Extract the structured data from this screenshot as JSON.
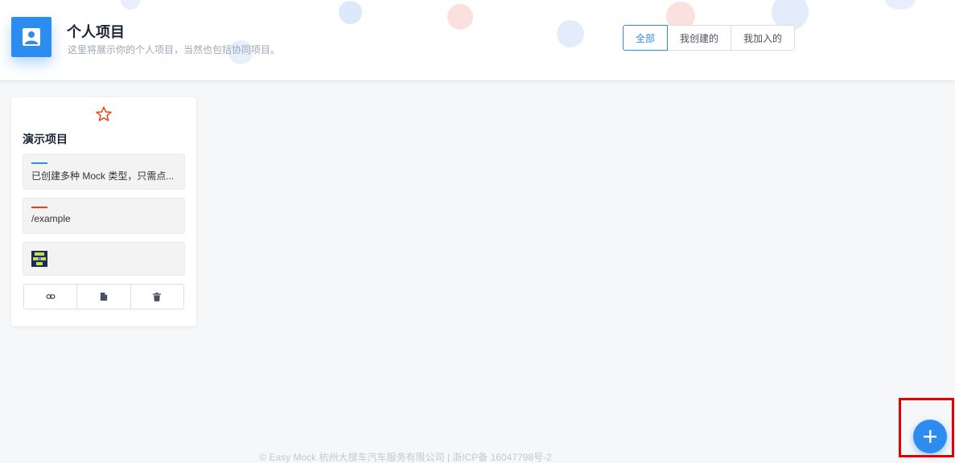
{
  "header": {
    "title": "个人项目",
    "subtitle": "这里将展示你的个人项目，当然也包括协同项目。",
    "avatar_icon": "user-icon",
    "accent_color": "#2d8cf0"
  },
  "filters": {
    "items": [
      "全部",
      "我创建的",
      "我加入的"
    ],
    "selected": "全部"
  },
  "project_card": {
    "star_icon": "star-outline-icon",
    "star_color": "#ed3f14",
    "title": "演示项目",
    "description": "已创建多种 Mock 类型，只需点...",
    "description_bar_color": "#2d8cf0",
    "url": "/example",
    "url_bar_color": "#ed3f14",
    "owner_avatar_icon": "pixel-avatar-icon",
    "actions": [
      "link-icon",
      "copy-icon",
      "trash-icon"
    ]
  },
  "footer": {
    "text": "© Easy Mock 杭州大搜车汽车服务有限公司 | 浙ICP备 16047798号-2"
  },
  "fab": {
    "icon": "plus-icon"
  }
}
